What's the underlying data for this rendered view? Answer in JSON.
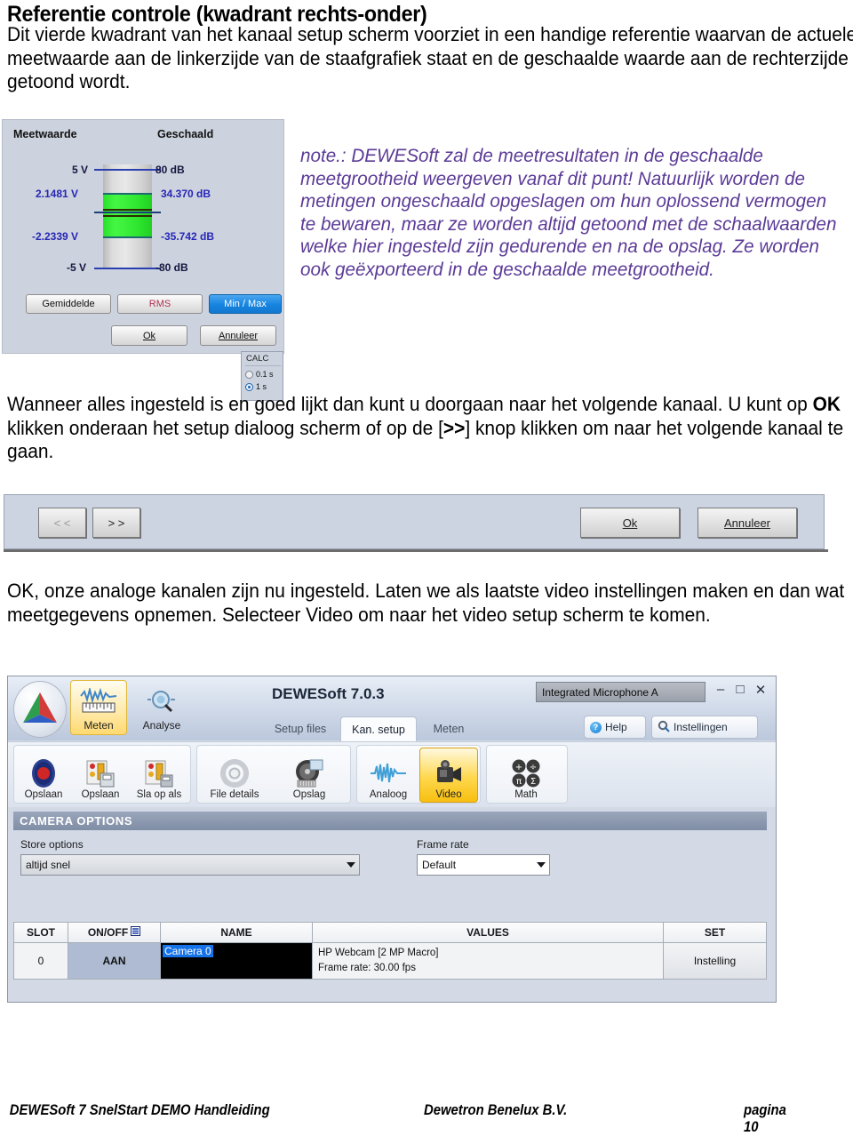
{
  "document": {
    "heading": "Referentie controle (kwadrant rechts-onder)",
    "intro_paragraph": "Dit vierde kwadrant van het kanaal setup scherm voorziet in een handige referentie waarvan de actuele meetwaarde aan de linkerzijde van de staafgrafiek staat en de geschaalde waarde aan de rechterzijde getoond wordt.",
    "note_paragraph": "note.: DEWESoft zal de meetresultaten in de geschaalde meetgrootheid weergeven vanaf dit punt! Natuurlijk worden de metingen ongeschaald opgeslagen om hun oplossend vermogen te bewaren, maar ze worden altijd getoond met de schaalwaarden welke hier ingesteld zijn gedurende en na de opslag. Ze worden ook geëxporteerd in de geschaalde meetgrootheid.",
    "mid_paragraph_part1": "Wanneer alles ingesteld is en goed lijkt dan kunt u doorgaan naar het volgende kanaal. U kunt op ",
    "mid_paragraph_bold1": "OK",
    "mid_paragraph_part2": " klikken onderaan het setup dialoog scherm of op de [",
    "mid_paragraph_bold2": ">>",
    "mid_paragraph_part3": "] knop klikken om naar het volgende kanaal te gaan.",
    "bottom_paragraph": "OK, onze analoge kanalen zijn nu ingesteld. Laten we als laatste video instellingen maken en dan wat meetgegevens opnemen. Selecteer Video om naar het video setup scherm te komen."
  },
  "measurement_widget": {
    "column_headers": {
      "measured": "Meetwaarde",
      "scaled": "Geschaald"
    },
    "scale": {
      "top_measured": "5 V",
      "top_scaled": "80 dB",
      "max_measured": "2.1481 V",
      "max_scaled": "34.370 dB",
      "min_measured": "-2.2339 V",
      "min_scaled": "-35.742 dB",
      "bottom_measured": "-5 V",
      "bottom_scaled": "-80 dB"
    },
    "calc_group": {
      "title": "CALC",
      "options": [
        {
          "label": "0.1 s",
          "selected": false
        },
        {
          "label": "1 s",
          "selected": true
        }
      ]
    },
    "buttons": {
      "average": "Gemiddelde",
      "rms": "RMS",
      "minmax": "Min / Max",
      "ok": "Ok",
      "cancel": "Annuleer"
    },
    "colors": {
      "panel_bg": "#ccd2de",
      "bar_fill": "#33e633",
      "value_text": "#2727b5",
      "selected_button": "#1684e0",
      "rms_text": "#b03050"
    }
  },
  "nav_strip": {
    "prev_label": "< <",
    "next_label": "> >",
    "ok_label": "Ok",
    "cancel_label": "Annuleer"
  },
  "app": {
    "title": "DEWESoft 7.0.3",
    "device_combo_value": "Integrated Microphone A",
    "window_controls": {
      "minimize": "–",
      "maximize": "□",
      "close": "✕"
    },
    "mode_buttons": [
      {
        "label": "Meten",
        "icon": "waveform-ruler-icon",
        "active": true
      },
      {
        "label": "Analyse",
        "icon": "magnifier-icon",
        "active": false
      }
    ],
    "tabs": [
      {
        "label": "Setup files",
        "active": false
      },
      {
        "label": "Kan. setup",
        "active": true
      },
      {
        "label": "Meten",
        "active": false
      }
    ],
    "header_buttons": [
      {
        "label": "Help",
        "icon": "question-icon"
      },
      {
        "label": "Instellingen",
        "icon": "gear-wrench-icon"
      }
    ],
    "toolbar_groups": [
      {
        "items": [
          {
            "label": "Opslaan",
            "icon": "record-icon",
            "active": false
          },
          {
            "label": "Opslaan",
            "icon": "save-panel-icon",
            "active": false
          },
          {
            "label": "Sla op als",
            "icon": "save-as-icon",
            "active": false
          }
        ]
      },
      {
        "items": [
          {
            "label": "File details",
            "icon": "gear-icon",
            "active": false
          },
          {
            "label": "Opslag",
            "icon": "harddisk-icon",
            "active": false
          }
        ]
      },
      {
        "items": [
          {
            "label": "Analoog",
            "icon": "waveform-icon",
            "active": false
          },
          {
            "label": "Video",
            "icon": "camcorder-icon",
            "active": true
          }
        ]
      },
      {
        "items": [
          {
            "label": "Math",
            "icon": "math-icon",
            "active": false
          }
        ]
      }
    ],
    "section_header": "CAMERA OPTIONS",
    "fields": {
      "store_options_label": "Store options",
      "store_options_value": "altijd snel",
      "frame_rate_label": "Frame rate",
      "frame_rate_value": "Default"
    },
    "grid": {
      "columns": [
        "SLOT",
        "ON/OFF",
        "NAME",
        "VALUES",
        "SET"
      ],
      "rows": [
        {
          "slot": "0",
          "onoff": "AAN",
          "name": "Camera  0",
          "values_line1": "HP Webcam [2 MP Macro]",
          "values_line2": "Frame rate: 30.00 fps",
          "set": "Instelling"
        }
      ]
    }
  },
  "footer": {
    "left": "DEWESoft 7 SnelStart DEMO Handleiding",
    "center": "Dewetron Benelux B.V.",
    "right": "pagina 10"
  }
}
